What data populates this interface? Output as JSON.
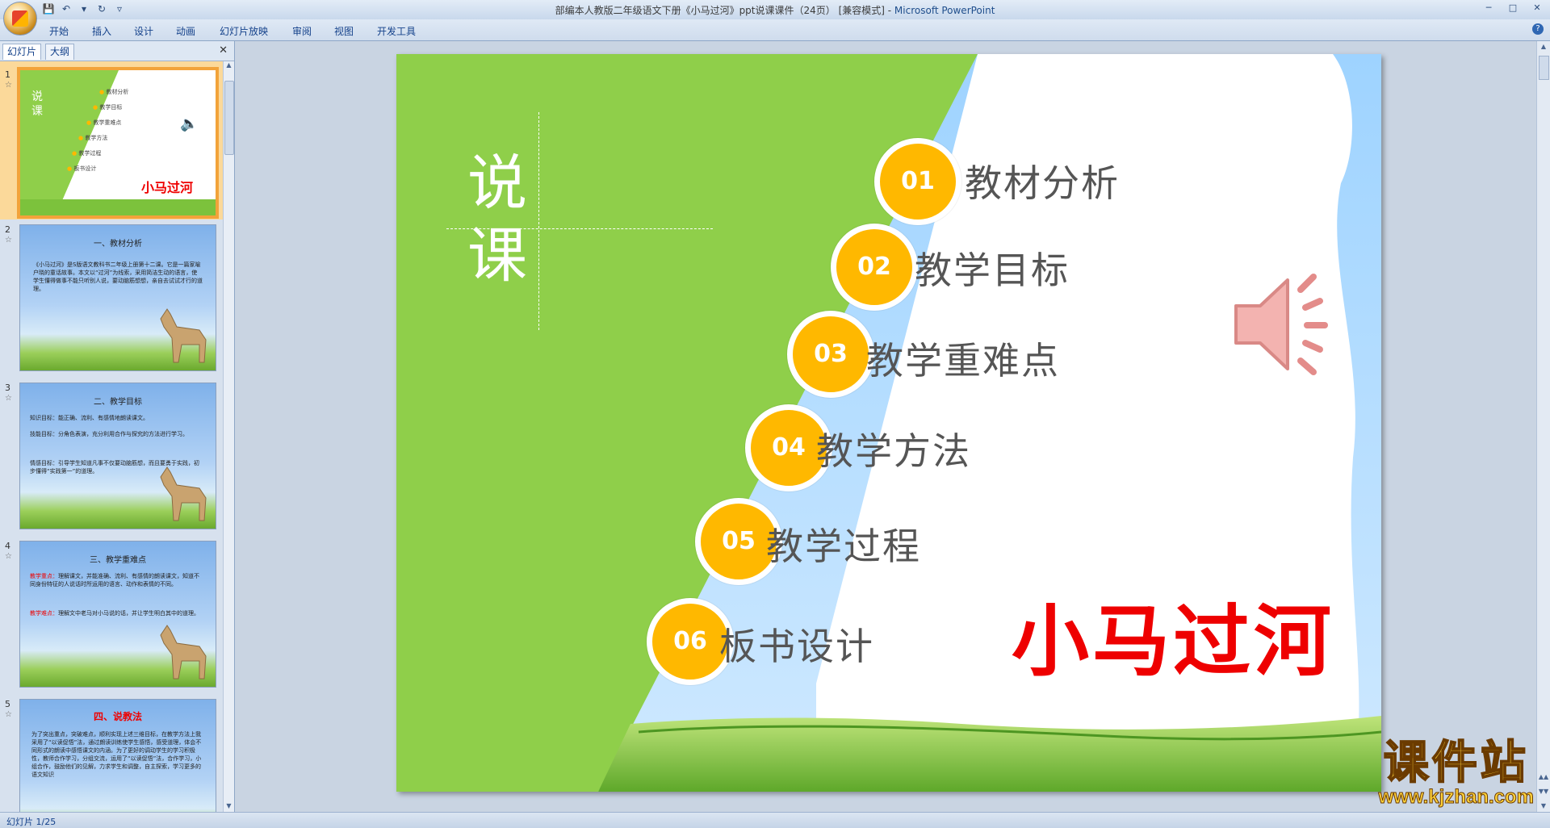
{
  "window": {
    "title": "部编本人教版二年级语文下册《小马过河》ppt说课课件（24页） [兼容模式] - ",
    "app_name": "Microsoft PowerPoint"
  },
  "ribbon": {
    "tabs": [
      "开始",
      "插入",
      "设计",
      "动画",
      "幻灯片放映",
      "审阅",
      "视图",
      "开发工具"
    ]
  },
  "panel": {
    "tabs": [
      "幻灯片",
      "大纲"
    ]
  },
  "slides": [
    {
      "num": "1",
      "thumb_items": [
        "教材分析",
        "教学目标",
        "教学重难点",
        "教学方法",
        "教学过程",
        "板书设计"
      ],
      "left": "说",
      "left2": "课",
      "title": "小马过河"
    },
    {
      "num": "2",
      "title": "一、教材分析",
      "body": "《小马过河》是S版语文教科书二年级上册第十二课。它是一篇家喻户晓的童话故事。本文以“过河”为线索，采用简洁生动的语言，使学生懂得做事不能只听别人说，要动脑筋想想，亲自去试试才行的道理。"
    },
    {
      "num": "3",
      "title": "二、教学目标",
      "body1": "知识目标：能正确、流利、有感情地朗读课文。",
      "body2": "技能目标：分角色表演，充分利用合作与探究的方法进行学习。",
      "body3": "情感目标：引导学生知道凡事不仅要动脑筋想，而且要勇于实践，初步懂得“实践第一”的道理。"
    },
    {
      "num": "4",
      "title": "三、教学重难点",
      "key_label": "教学重点：",
      "key": "理解课文，并能准确、流利、有感情的朗读课文，知道不同身份特征的人说话时所运用的语言、动作和表情的不同。",
      "hard_label": "教学难点：",
      "hard": "理解文中老马对小马说的话，并让学生明白其中的道理。"
    },
    {
      "num": "5",
      "title": "四、说教法",
      "body": "为了突出重点，突破难点，顺利实现上述三维目标，在教学方法上我采用了“以读促悟”法，通过朗读训练使学生感悟，感受道理，体会不同形式的朗读中感悟课文的内涵。为了更好的调动学生的学习积极性，教师合作学习，分组交流，运用了“以读促悟”法，合作学习，小组合作，鼓励他们的见解，力求学生和调整，自主探索，学习更多的语文知识"
    }
  ],
  "current_slide": {
    "left_chars": [
      "说",
      "课"
    ],
    "items": [
      {
        "num": "01",
        "label": "教材分析"
      },
      {
        "num": "02",
        "label": "教学目标"
      },
      {
        "num": "03",
        "label": "教学重难点"
      },
      {
        "num": "04",
        "label": "教学方法"
      },
      {
        "num": "05",
        "label": "教学过程"
      },
      {
        "num": "06",
        "label": "板书设计"
      }
    ],
    "title": "小马过河"
  },
  "status": {
    "slide_indicator": "幻灯片 1/25"
  },
  "watermark": {
    "brand": "课件站",
    "url": "www.kjzhan.com"
  },
  "colors": {
    "accent_green": "#8fcf4a",
    "circle_yellow": "#ffb800",
    "title_red": "#ee0000"
  }
}
